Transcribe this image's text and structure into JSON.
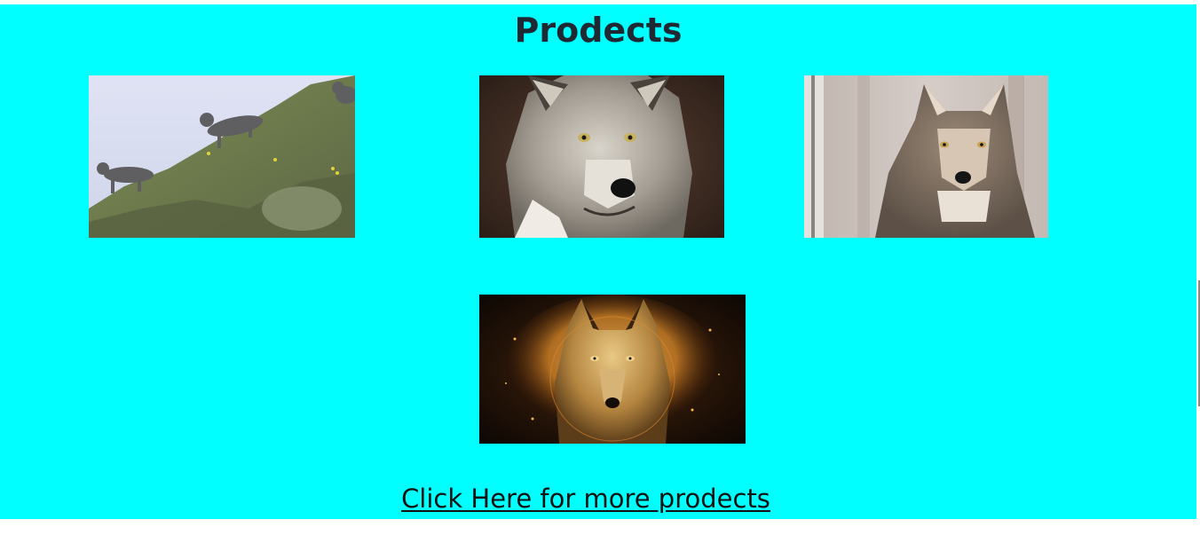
{
  "header": {
    "title": "Prodects"
  },
  "products": [
    {
      "image_name": "wolves-on-hillside-image"
    },
    {
      "image_name": "gray-wolf-portrait-image"
    },
    {
      "image_name": "wolf-in-forest-image"
    },
    {
      "image_name": "fiery-wolf-art-image"
    }
  ],
  "footer": {
    "more_link_label": "Click Here for more prodects"
  },
  "colors": {
    "panel_background": "#00ffff",
    "title_text": "#1f2933",
    "link_text": "#111111"
  }
}
